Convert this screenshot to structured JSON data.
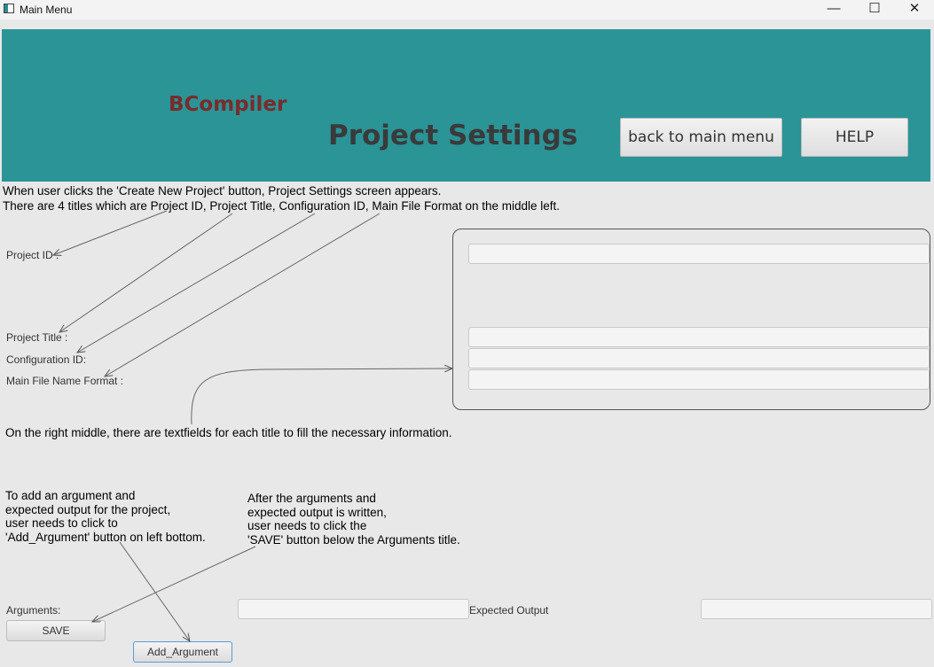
{
  "window": {
    "title": "Main Menu",
    "controls": {
      "minimize": "—",
      "maximize": "☐",
      "close": "✕"
    }
  },
  "header": {
    "brand": "BCompiler",
    "title": "Project Settings",
    "back_button": "back to main menu",
    "help_button": "HELP",
    "background": "#2a9497",
    "brand_color": "#7a2b2b"
  },
  "notes": {
    "intro_line1": "When user clicks the 'Create New Project' button, Project Settings screen appears.",
    "intro_line2": "There are 4 titles which are Project ID, Project Title, Configuration ID, Main File Format on the middle left.",
    "textfields": "On the right middle, there are textfields for each title to fill the necessary information.",
    "add_argument": "To add an argument and\nexpected output for the project,\nuser needs to click to\n'Add_Argument' button on left bottom.",
    "save": "After the arguments and\nexpected output is written,\nuser needs to click the\n'SAVE' button below the Arguments title."
  },
  "form": {
    "project_id_label": "Project ID :",
    "project_title_label": "Project Title :",
    "configuration_id_label": "Configuration ID:",
    "main_file_label": "Main File Name Format :",
    "project_id_value": "",
    "project_title_value": "",
    "configuration_id_value": "",
    "main_file_value": ""
  },
  "arguments": {
    "arguments_label": "Arguments:",
    "expected_output_label": "Expected Output",
    "argument_value": "",
    "expected_output_value": "",
    "save_button": "SAVE",
    "add_argument_button": "Add_Argument"
  }
}
